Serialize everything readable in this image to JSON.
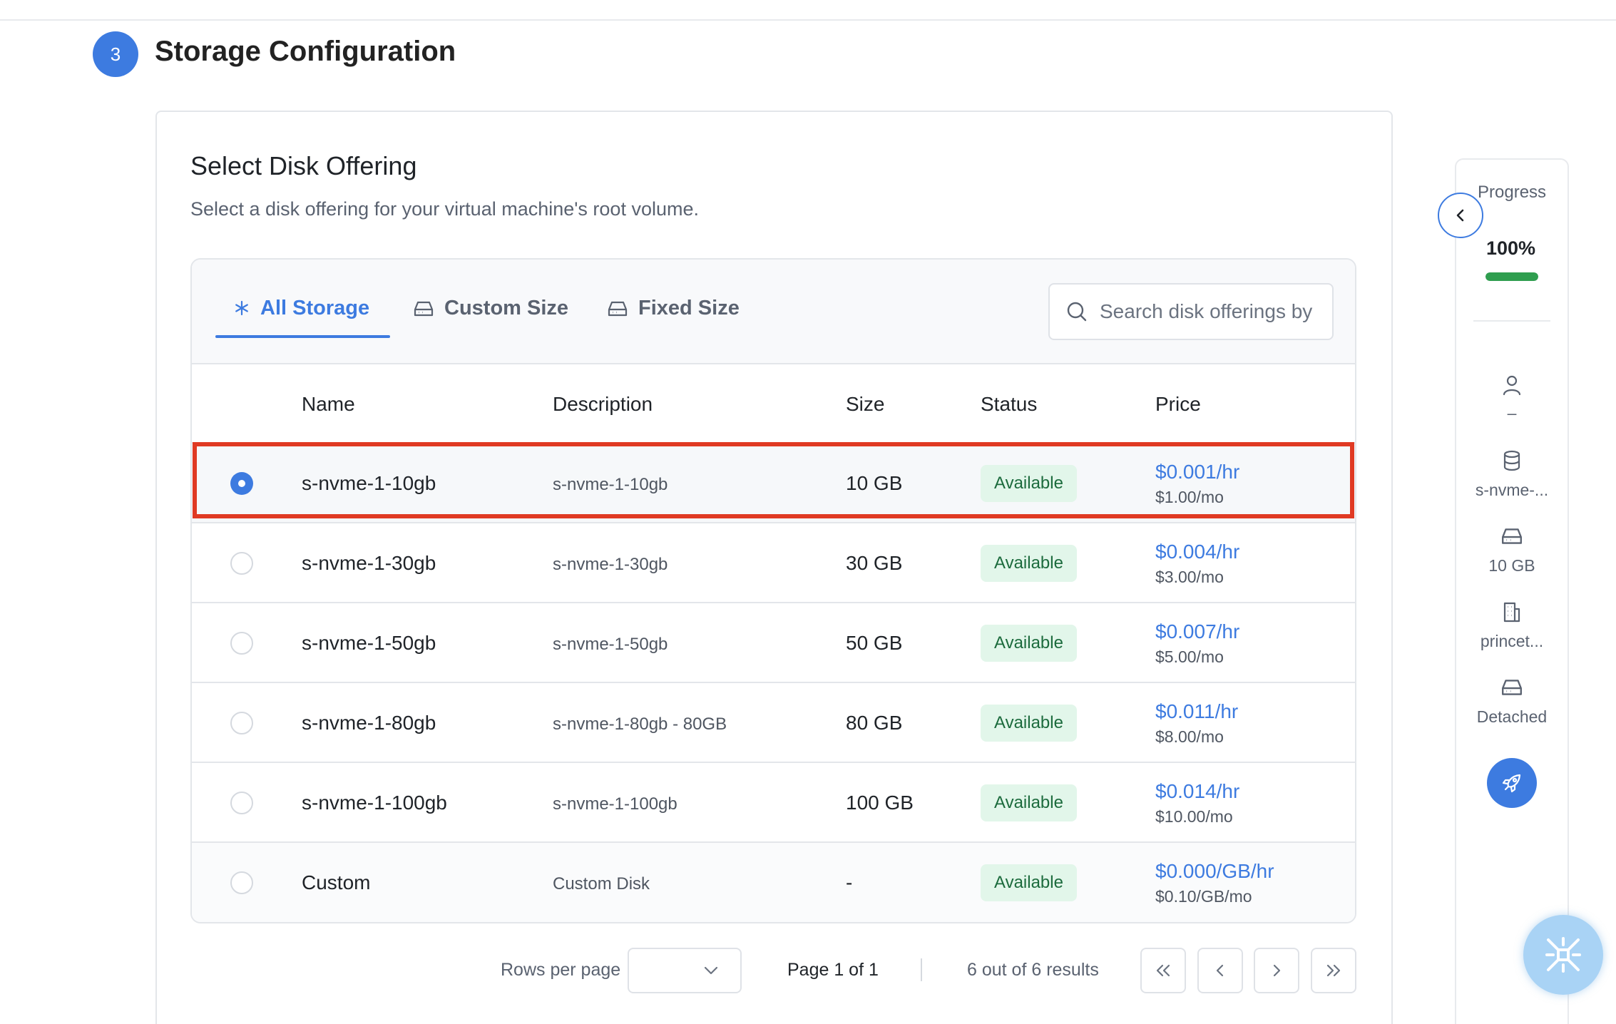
{
  "step": {
    "number": "3",
    "title": "Storage Configuration"
  },
  "card": {
    "title": "Select Disk Offering",
    "subtitle": "Select a disk offering for your virtual machine's root volume."
  },
  "tabs": [
    {
      "label": "All Storage",
      "icon": "asterisk-icon",
      "active": true
    },
    {
      "label": "Custom Size",
      "icon": "hard-drive-icon",
      "active": false
    },
    {
      "label": "Fixed Size",
      "icon": "hard-drive-icon",
      "active": false
    }
  ],
  "search": {
    "placeholder": "Search disk offerings by"
  },
  "table": {
    "columns": [
      "Name",
      "Description",
      "Size",
      "Status",
      "Price"
    ],
    "rows": [
      {
        "name": "s-nvme-1-10gb",
        "description": "s-nvme-1-10gb",
        "size": "10 GB",
        "status": "Available",
        "price_hr": "$0.001/hr",
        "price_mo": "$1.00/mo",
        "selected": true
      },
      {
        "name": "s-nvme-1-30gb",
        "description": "s-nvme-1-30gb",
        "size": "30 GB",
        "status": "Available",
        "price_hr": "$0.004/hr",
        "price_mo": "$3.00/mo",
        "selected": false
      },
      {
        "name": "s-nvme-1-50gb",
        "description": "s-nvme-1-50gb",
        "size": "50 GB",
        "status": "Available",
        "price_hr": "$0.007/hr",
        "price_mo": "$5.00/mo",
        "selected": false
      },
      {
        "name": "s-nvme-1-80gb",
        "description": "s-nvme-1-80gb - 80GB",
        "size": "80 GB",
        "status": "Available",
        "price_hr": "$0.011/hr",
        "price_mo": "$8.00/mo",
        "selected": false
      },
      {
        "name": "s-nvme-1-100gb",
        "description": "s-nvme-1-100gb",
        "size": "100 GB",
        "status": "Available",
        "price_hr": "$0.014/hr",
        "price_mo": "$10.00/mo",
        "selected": false
      },
      {
        "name": "Custom",
        "description": "Custom Disk",
        "size": "-",
        "status": "Available",
        "price_hr": "$0.000/GB/hr",
        "price_mo": "$0.10/GB/mo",
        "selected": false
      }
    ]
  },
  "pagination": {
    "rows_per_page_label": "Rows per page",
    "rows_per_page_value": "",
    "page_info": "Page 1 of 1",
    "result_info": "6 out of 6 results"
  },
  "progress_panel": {
    "label": "Progress",
    "value": "100%",
    "fraction": 1.0,
    "items": [
      {
        "icon": "user-icon",
        "text": "–"
      },
      {
        "icon": "database-icon",
        "text": "s-nvme-..."
      },
      {
        "icon": "hard-drive-icon",
        "text": "10 GB"
      },
      {
        "icon": "building-icon",
        "text": "princet..."
      },
      {
        "icon": "hard-drive-icon",
        "text": "Detached"
      }
    ]
  },
  "colors": {
    "accent": "#3d7be0",
    "status_bg": "#e2f6ea",
    "status_text": "#1c6b3d",
    "highlight": "#e03a23",
    "progress": "#2f9e4f"
  }
}
